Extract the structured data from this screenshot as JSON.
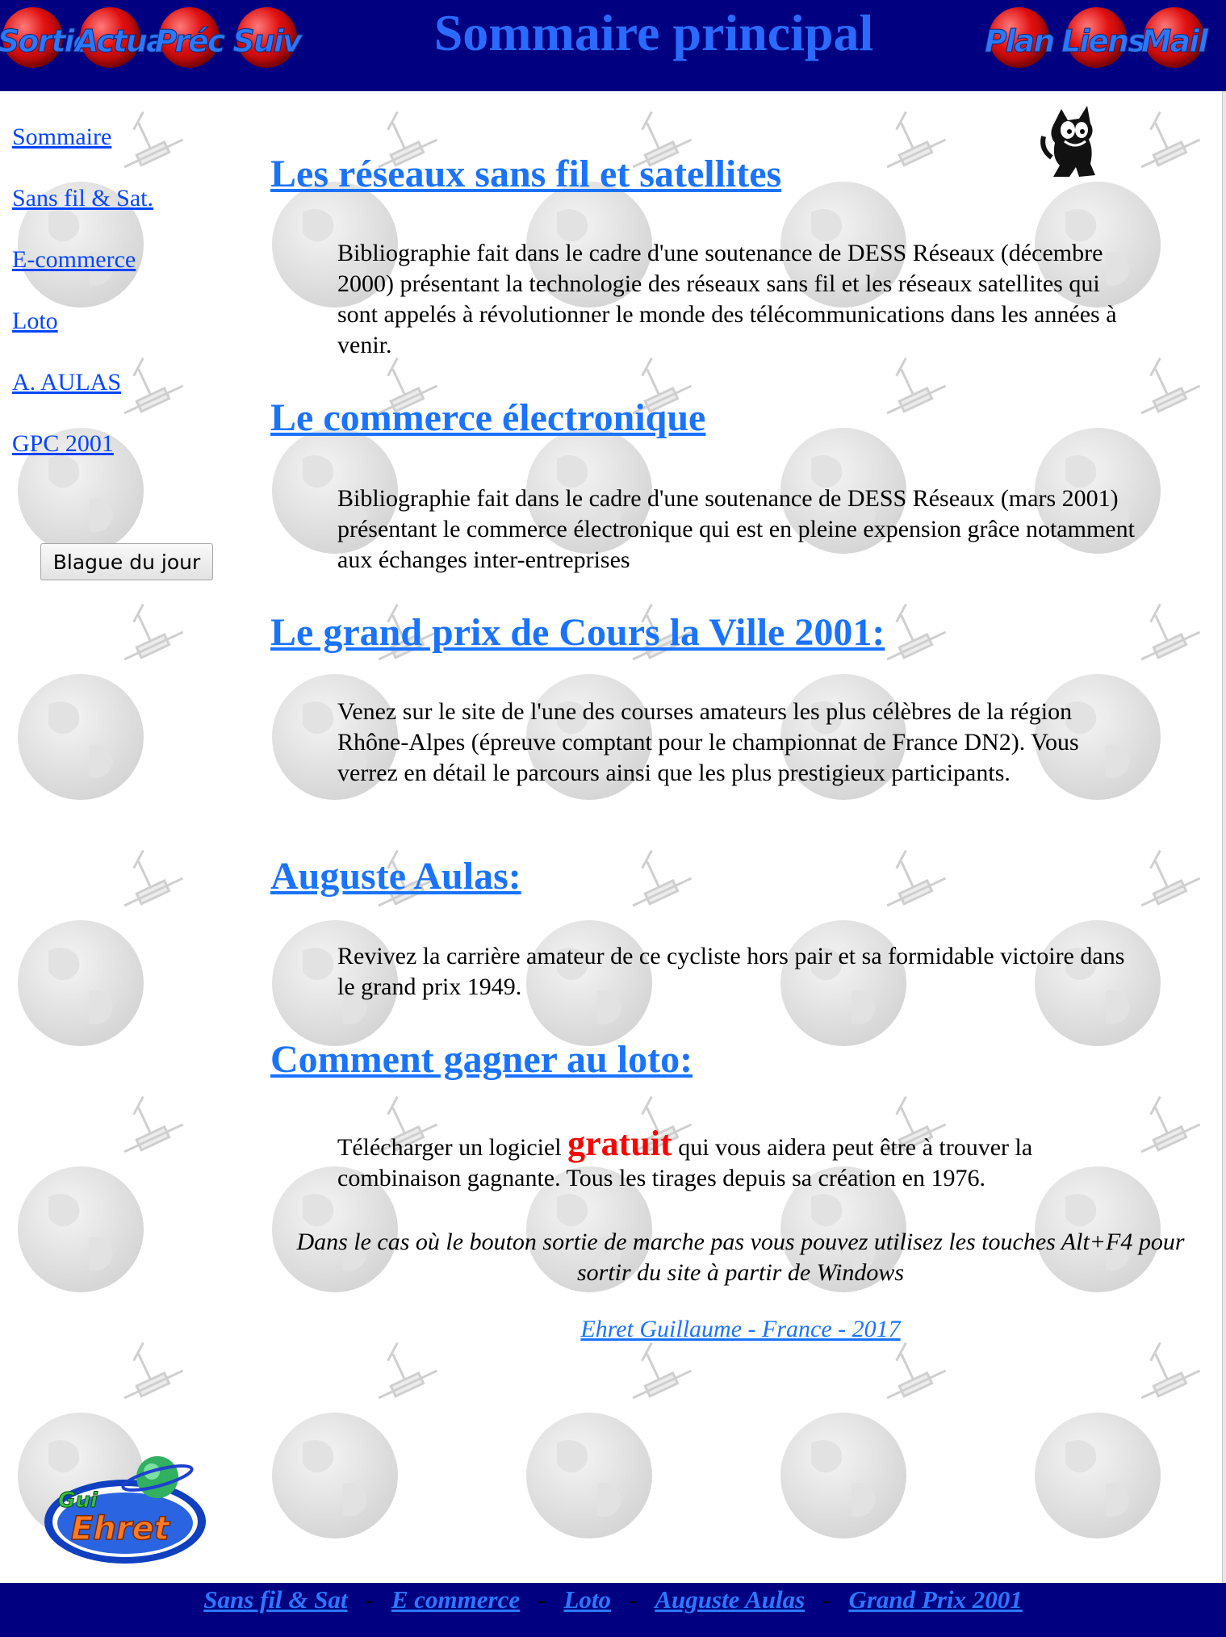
{
  "header": {
    "title": "Sommaire principal",
    "nav_left": [
      "Sortie",
      "Actual",
      "Préc",
      "Suiv"
    ],
    "nav_right": [
      "Plan",
      "Liens",
      "Mail"
    ]
  },
  "sidebar": {
    "links": [
      "Sommaire",
      "Sans fil & Sat.",
      "E-commerce",
      "Loto",
      "A. AULAS",
      "GPC 2001"
    ],
    "joke_button": "Blague du jour"
  },
  "sections": [
    {
      "title": "Les réseaux sans fil et satellites",
      "description": "Bibliographie fait dans le cadre d'une soutenance de DESS Réseaux (décembre 2000) présentant la technologie des réseaux sans fil et les réseaux satellites qui sont appelés à révolutionner le monde des télécommunications dans les années à venir."
    },
    {
      "title": "Le commerce électronique",
      "description": "Bibliographie fait dans le cadre d'une soutenance de DESS Réseaux (mars 2001) présentant le commerce électronique qui est en pleine expension grâce notamment aux échanges inter-entreprises"
    },
    {
      "title": "Le grand prix de Cours la Ville 2001:",
      "description": "Venez sur le site de l'une des courses amateurs les plus célèbres de la région Rhône-Alpes (épreuve comptant pour le championnat de France DN2). Vous verrez en détail le parcours ainsi que les plus prestigieux participants."
    },
    {
      "title": "Auguste Aulas:",
      "description": "Revivez la carrière amateur de ce cycliste hors pair et sa formidable victoire dans le grand prix 1949."
    },
    {
      "title": "Comment gagner au loto:",
      "description_before": "Télécharger un logiciel",
      "highlight": "gratuit",
      "description_after": "qui vous aidera peut être à trouver la combinaison gagnante. Tous les tirages depuis sa création en 1976."
    }
  ],
  "footer_note": "Dans le cas où le bouton sortie de marche pas vous pouvez utilisez les touches Alt+F4 pour sortir du site à partir de Windows",
  "author": "Ehret Guillaume - France - 2017",
  "logo": {
    "line1": "Gui",
    "line2": "Ehret"
  },
  "bottom_nav": [
    "Sans fil & Sat",
    "E commerce",
    "Loto",
    "Auguste Aulas",
    "Grand Prix 2001"
  ],
  "colors": {
    "header_bg": "#000080",
    "title": "#2a6aff",
    "link": "#1a73ff",
    "nav_ball": "#e01010",
    "highlight": "#ff0000"
  },
  "icons": [
    "cat-mascot-icon",
    "globe-satellite-pattern"
  ]
}
